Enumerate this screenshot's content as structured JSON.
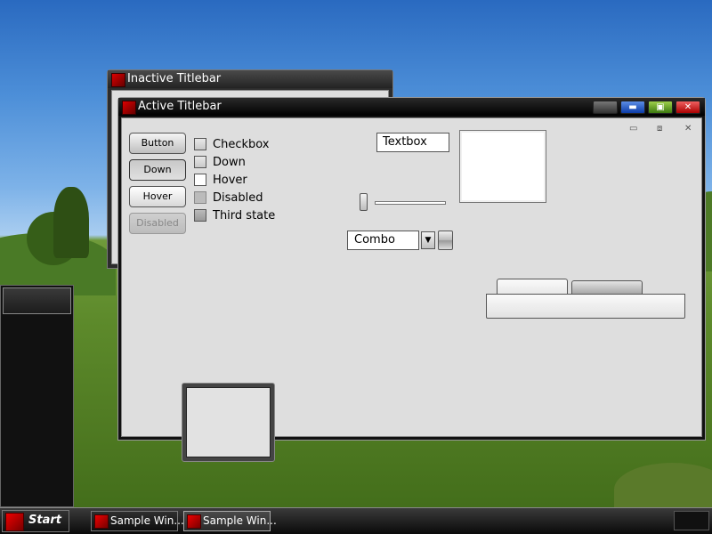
{
  "windows": {
    "inactive": {
      "title": "Inactive Titlebar"
    },
    "active": {
      "title": "Active Titlebar",
      "caption_min": "▬",
      "caption_max": "▣",
      "caption_close": "✕"
    }
  },
  "controls": {
    "buttons": [
      "Button",
      "Down",
      "Hover",
      "Disabled"
    ],
    "checkboxes": [
      "Checkbox",
      "Down",
      "Hover",
      "Disabled",
      "Third state"
    ],
    "textbox_value": "Textbox",
    "combo_value": "Combo",
    "combo_arrow": "▼"
  },
  "mdi": {
    "minimize": "▭",
    "restore": "⧈",
    "close": "✕"
  },
  "taskbar": {
    "start_label": "Start",
    "tasks": [
      "Sample Win...",
      "Sample Win..."
    ]
  }
}
